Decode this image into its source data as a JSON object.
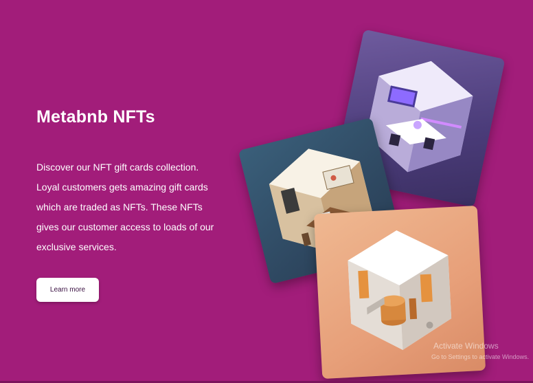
{
  "hero": {
    "title": "Metabnb NFTs",
    "description": "Discover our NFT gift cards collection. Loyal customers gets amazing gift cards which are traded as NFTs. These NFTs gives our customer access to loads of our exclusive services.",
    "button_label": "Learn more"
  },
  "cards": [
    {
      "icon": "gaming-room-isometric-image"
    },
    {
      "icon": "office-room-isometric-image"
    },
    {
      "icon": "lab-room-isometric-image"
    }
  ],
  "watermark": {
    "title": "Activate Windows",
    "subtitle": "Go to Settings to activate Windows."
  },
  "colors": {
    "background": "#a21d7a",
    "text": "#ffffff",
    "button_bg": "#ffffff",
    "button_text": "#3a1042"
  }
}
